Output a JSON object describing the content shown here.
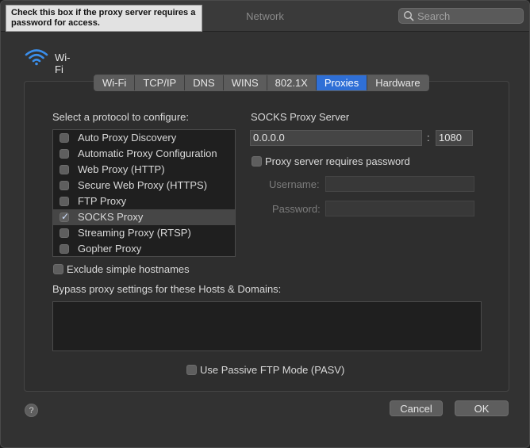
{
  "window": {
    "title": "Network"
  },
  "search": {
    "placeholder": "Search"
  },
  "tooltip": {
    "text": "Check this box if the proxy server requires a password for access."
  },
  "service": {
    "name": "Wi-Fi"
  },
  "tabs": [
    {
      "label": "Wi-Fi",
      "active": false
    },
    {
      "label": "TCP/IP",
      "active": false
    },
    {
      "label": "DNS",
      "active": false
    },
    {
      "label": "WINS",
      "active": false
    },
    {
      "label": "802.1X",
      "active": false
    },
    {
      "label": "Proxies",
      "active": true
    },
    {
      "label": "Hardware",
      "active": false
    }
  ],
  "protocols": {
    "heading": "Select a protocol to configure:",
    "items": [
      {
        "label": "Auto Proxy Discovery",
        "checked": false
      },
      {
        "label": "Automatic Proxy Configuration",
        "checked": false
      },
      {
        "label": "Web Proxy (HTTP)",
        "checked": false
      },
      {
        "label": "Secure Web Proxy (HTTPS)",
        "checked": false
      },
      {
        "label": "FTP Proxy",
        "checked": false
      },
      {
        "label": "SOCKS Proxy",
        "checked": true,
        "selected": true
      },
      {
        "label": "Streaming Proxy (RTSP)",
        "checked": false
      },
      {
        "label": "Gopher Proxy",
        "checked": false
      }
    ]
  },
  "proxy_server": {
    "heading": "SOCKS Proxy Server",
    "host": "0.0.0.0",
    "separator": ":",
    "port": "1080",
    "requires_password_label": "Proxy server requires password",
    "requires_password": false,
    "username_label": "Username:",
    "username": "",
    "password_label": "Password:",
    "password": ""
  },
  "exclude_simple": {
    "label": "Exclude simple hostnames",
    "checked": false
  },
  "bypass": {
    "label": "Bypass proxy settings for these Hosts & Domains:",
    "value": ""
  },
  "passive_ftp": {
    "label": "Use Passive FTP Mode (PASV)",
    "checked": false
  },
  "buttons": {
    "help": "?",
    "cancel": "Cancel",
    "ok": "OK"
  },
  "colors": {
    "accent": "#2f6fd6",
    "wifi": "#3b8eea"
  }
}
